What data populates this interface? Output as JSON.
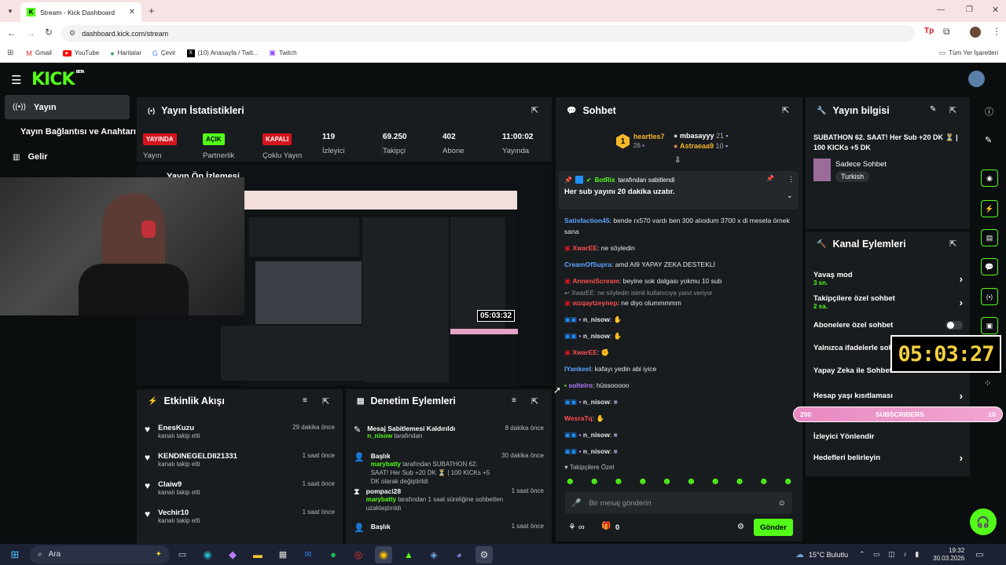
{
  "browser": {
    "tab_title": "Stream - Kick Dashboard",
    "url": "dashboard.kick.com/stream",
    "bookmarks": [
      "Gmail",
      "YouTube",
      "Haritalar",
      "Çevir",
      "(10) Anasayfa / Twit...",
      "Twitch"
    ],
    "all_bookmarks": "Tüm Yer İşaretleri"
  },
  "brand": {
    "logo": "KICK",
    "beta": "BETA"
  },
  "sidebar": {
    "items": [
      {
        "label": "Yayın"
      },
      {
        "label": "Yayın Bağlantısı ve Anahtarı"
      },
      {
        "label": "Gelir"
      }
    ]
  },
  "stats": {
    "title": "Yayın İstatistikleri",
    "live_badge": "YAYINDA",
    "live_label": "Yayın",
    "partner_badge": "AÇIK",
    "partner_label": "Partnerlik",
    "multi_badge": "KAPALI",
    "multi_label": "Çoklu Yayın",
    "viewers": "119",
    "viewers_label": "İzleyici",
    "followers": "69.250",
    "followers_label": "Takipçi",
    "subs": "402",
    "subs_label": "Abone",
    "uptime": "11:00:02",
    "uptime_label": "Yayında"
  },
  "preview": {
    "title": "Yayın Ön İzlemesi",
    "inner_timer": "05:03:32"
  },
  "overlay_timer": "05:03:27",
  "subathon_bar": {
    "left": "200",
    "label": "SUBSCRIBERS",
    "right": "10"
  },
  "events": {
    "title": "Etkinlik Akışı",
    "items": [
      {
        "name": "EnesKuzu",
        "sub": "kanalı takip etti",
        "time": "29 dakika önce"
      },
      {
        "name": "KENDINEGELDII21331",
        "sub": "kanalı takip etti",
        "time": "1 saat önce"
      },
      {
        "name": "Claiw9",
        "sub": "kanalı takip etti",
        "time": "1 saat önce"
      },
      {
        "name": "Vechir10",
        "sub": "kanalı takip etti",
        "time": "1 saat önce"
      }
    ]
  },
  "moderation": {
    "title": "Denetim Eylemleri",
    "items": [
      {
        "title": "Mesaj Sabitlemesi Kaldırıldı",
        "user": "n_nisow",
        "rest": " tarafından",
        "time": "8 dakika önce"
      },
      {
        "title": "Başlık",
        "user": "marybatty",
        "rest": " tarafından SUBATHON 62. SAAT! Her Sub +20 DK ⏳ | 100 KICKs +5 DK olarak değiştirildi",
        "time": "30 dakika önce"
      },
      {
        "title": "pompaci28",
        "user": "marybatty",
        "rest": " tarafından 1 saat süreliğine sohbetten uzaklaştırıldı",
        "time": "1 saat önce"
      },
      {
        "title": "Başlık",
        "user": "",
        "rest": "",
        "time": "1 saat önce"
      }
    ]
  },
  "chat": {
    "title": "Sohbet",
    "leaders": [
      {
        "rank": "1",
        "name": "heartles7",
        "count": "26"
      },
      {
        "name": "mbasayyy",
        "count": "21"
      },
      {
        "name": "Astraeaa9",
        "count": "10"
      }
    ],
    "pinned_by": "BotRix",
    "pinned_suffix": " tarafından sabitlendi",
    "pinned_message": "Her sub yayını 20 dakika uzatır.",
    "messages": [
      {
        "user": "Satisfaction45",
        "color": "#5fa2ff",
        "text": ": bende rx570 vardı ben 300 alıodum 3700 x di mesela örnek sana"
      },
      {
        "user": "XwarEE",
        "color": "#ff4f4f",
        "text": ": ne söyledin"
      },
      {
        "user": "CreamOfSupra",
        "color": "#5fa2ff",
        "text": ": amd AI9 YAPAY ZEKA DESTEKLİ"
      },
      {
        "user": "AnneniScream",
        "color": "#ff4f4f",
        "text": ": beyine sok dalgası yokmu 10 sub"
      },
      {
        "reply": "XwarEE: ne söyledin isimli kullanıcıya yanıt veriyor",
        "user": "wzqaytzeynep",
        "color": "#ff4f4f",
        "text": ": ne diyo olummmmm"
      },
      {
        "user": "n_nisow",
        "color": "#e6e9ea",
        "text": ":"
      },
      {
        "user": "n_nisow",
        "color": "#e6e9ea",
        "text": ":"
      },
      {
        "user": "XwarEE",
        "color": "#ff4f4f",
        "text": ":"
      },
      {
        "user": "IYankeel",
        "color": "#5fa2ff",
        "text": ": kafayı yedin abi iyice"
      },
      {
        "user": "solteiro",
        "color": "#b57cff",
        "text": ": hüssooooo"
      },
      {
        "user": "n_nisow",
        "color": "#e6e9ea",
        "text": ":"
      },
      {
        "user": "WesraTq",
        "color": "#ff4f4f",
        "text": ":"
      },
      {
        "user": "n_nisow",
        "color": "#e6e9ea",
        "text": ":"
      },
      {
        "user": "n_nisow",
        "color": "#e6e9ea",
        "text": ":"
      }
    ],
    "emote_tab": "Takipçilere Özel",
    "input_placeholder": "Bir mesaj gönderin",
    "count": "0",
    "send": "Gönder"
  },
  "stream_info": {
    "title": "Yayın bilgisi",
    "stream_title": "SUBATHON 62. SAAT! Her Sub +20 DK ⏳ | 100 KICKs +5 DK",
    "category": "Sadece Sohbet",
    "tag": "Turkish"
  },
  "channel_actions": {
    "title": "Kanal Eylemleri",
    "items": [
      {
        "label": "Yavaş mod",
        "sub": "3 sn."
      },
      {
        "label": "Takipçilere özel sohbet",
        "sub": "2 sa."
      },
      {
        "label": "Abonelere özel sohbet",
        "sub": ""
      },
      {
        "label": "Yalnızca ifadelerle sohbet",
        "sub": ""
      },
      {
        "label": "Yapay Zeka ile Sohbet",
        "sub": ""
      },
      {
        "label": "Hesap yaşı kısıtlaması",
        "sub": ""
      },
      {
        "label": "İzleyici Yönlendir",
        "sub": ""
      },
      {
        "label": "Hedefleri belirleyin",
        "sub": ""
      }
    ]
  },
  "taskbar": {
    "search": "Ara",
    "weather": "15°C Bulutlu",
    "time": "19:32",
    "date": "30.03.2026"
  },
  "colors": {
    "accent": "#53fc18",
    "live": "#d5151e",
    "panel": "#181c1f"
  }
}
